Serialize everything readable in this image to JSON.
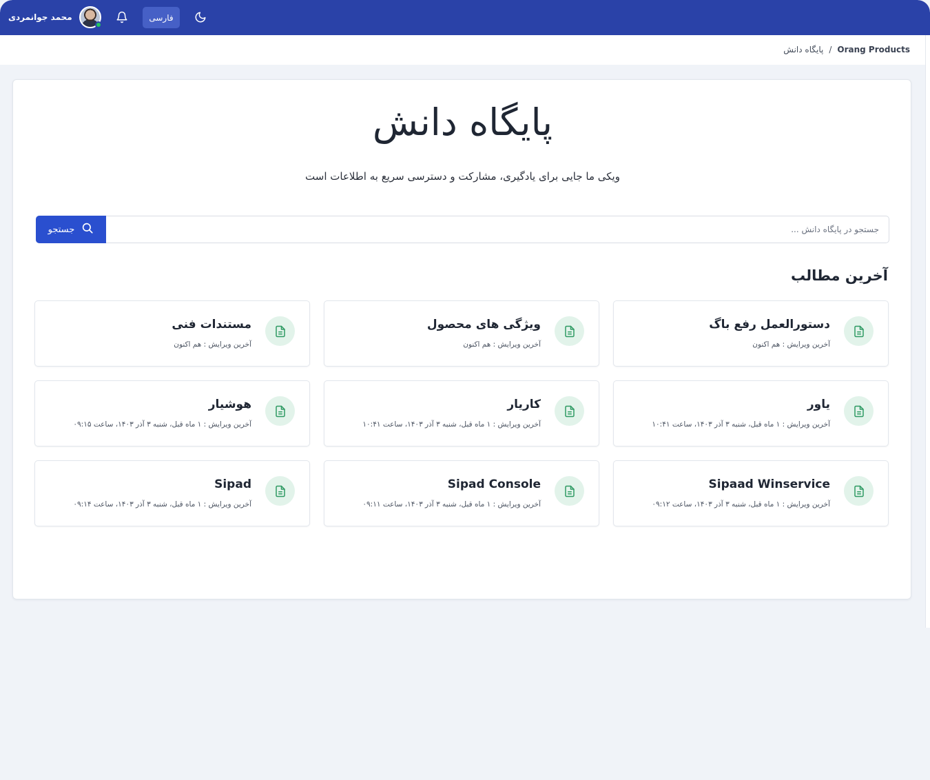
{
  "header": {
    "user_name": "محمد جوانمردی",
    "language_label": "فارسی"
  },
  "breadcrumb": {
    "root": "Orang Products",
    "separator": "/",
    "current": "پایگاه دانش"
  },
  "hero": {
    "title": "پایگاه دانش",
    "subtitle": "ویکی ما جایی برای یادگیری، مشارکت و دسترسی سریع به اطلاعات است"
  },
  "search": {
    "placeholder": "جستجو در پایگاه دانش ...",
    "button_label": "جستجو"
  },
  "latest": {
    "title": "آخرین مطالب",
    "items": [
      {
        "title": "دستورالعمل رفع باگ",
        "meta": "آخرین ویرایش : هم اکنون",
        "icon": "document-icon"
      },
      {
        "title": "ویژگی های محصول",
        "meta": "آخرین ویرایش : هم اکنون",
        "icon": "document-icon"
      },
      {
        "title": "مستندات فنی",
        "meta": "آخرین ویرایش : هم اکنون",
        "icon": "document-icon"
      },
      {
        "title": "یاور",
        "meta": "آخرین ویرایش : ۱ ماه قبل، شنبه ۳ آذر ۱۴۰۳، ساعت ۱۰:۴۱",
        "icon": "document-icon"
      },
      {
        "title": "کاریار",
        "meta": "آخرین ویرایش : ۱ ماه قبل، شنبه ۳ آذر ۱۴۰۳، ساعت ۱۰:۴۱",
        "icon": "document-icon"
      },
      {
        "title": "هوشیار",
        "meta": "آخرین ویرایش : ۱ ماه قبل، شنبه ۳ آذر ۱۴۰۳، ساعت ۰۹:۱۵",
        "icon": "document-icon"
      },
      {
        "title": "Sipaad Winservice",
        "meta": "آخرین ویرایش : ۱ ماه قبل، شنبه ۳ آذر ۱۴۰۳، ساعت ۰۹:۱۲",
        "icon": "document-icon"
      },
      {
        "title": "Sipad Console",
        "meta": "آخرین ویرایش : ۱ ماه قبل، شنبه ۳ آذر ۱۴۰۳، ساعت ۰۹:۱۱",
        "icon": "document-icon"
      },
      {
        "title": "Sipad",
        "meta": "آخرین ویرایش : ۱ ماه قبل، شنبه ۳ آذر ۱۴۰۳، ساعت ۰۹:۱۴",
        "icon": "document-icon"
      }
    ]
  },
  "colors": {
    "topbar": "#2a42a8",
    "primary_button": "#2a4fcf",
    "icon_bg": "#e2f3ea",
    "icon_fg": "#2e9a63",
    "page_bg": "#f0f3f8"
  }
}
